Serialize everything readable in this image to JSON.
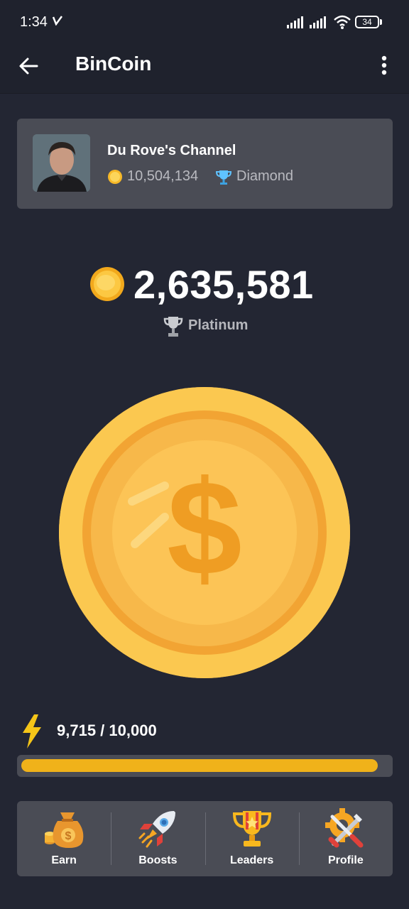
{
  "status_bar": {
    "time": "1:34",
    "battery": "34"
  },
  "app_bar": {
    "title": "BinCoin",
    "back_icon": "arrow-left-icon",
    "menu_icon": "more-vertical-icon"
  },
  "channel": {
    "name": "Du Rove's Channel",
    "coins": "10,504,134",
    "league": "Diamond"
  },
  "balance": {
    "value": "2,635,581",
    "league": "Platinum"
  },
  "energy": {
    "text": "9,715 / 10,000",
    "current": 9715,
    "max": 10000,
    "fill_fraction": 0.9715
  },
  "nav": {
    "items": [
      {
        "label": "Earn",
        "icon": "money-bag-icon"
      },
      {
        "label": "Boosts",
        "icon": "rocket-icon"
      },
      {
        "label": "Leaders",
        "icon": "trophy-icon"
      },
      {
        "label": "Profile",
        "icon": "gear-tools-icon"
      }
    ]
  },
  "colors": {
    "background": "#232633",
    "card": "#4a4c55",
    "accent": "#f0b21a",
    "coin": "#f9c34c"
  }
}
